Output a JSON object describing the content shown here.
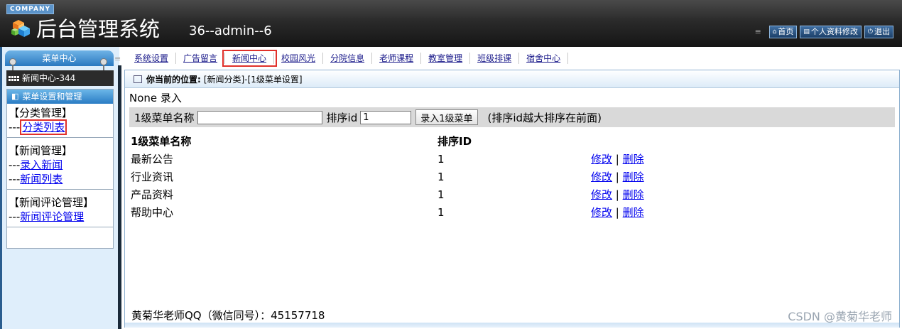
{
  "header": {
    "company": "COMPANY",
    "title": "后台管理系统",
    "user_info": "36--admin--6",
    "buttons": [
      {
        "label": "首页",
        "icon": "home-icon"
      },
      {
        "label": "个人资料修改",
        "icon": "list-icon"
      },
      {
        "label": "退出",
        "icon": "power-icon"
      }
    ]
  },
  "sidebar": {
    "menu_tab": "菜单中心",
    "news_center": "新闻中心-344",
    "box_title": "菜单设置和管理",
    "groups": [
      {
        "title": "【分类管理】",
        "links": [
          {
            "dash": "---",
            "label": "分类列表"
          }
        ]
      },
      {
        "title": "【新闻管理】",
        "links": [
          {
            "dash": "---",
            "label": "录入新闻"
          },
          {
            "dash": "---",
            "label": "新闻列表"
          }
        ]
      },
      {
        "title": "【新闻评论管理】",
        "links": [
          {
            "dash": "---",
            "label": "新闻评论管理"
          }
        ]
      }
    ]
  },
  "nav": {
    "tabs": [
      "系统设置",
      "广告留言",
      "新闻中心",
      "校园风光",
      "分院信息",
      "老师课程",
      "教室管理",
      "班级排课",
      "宿舍中心"
    ],
    "active": "新闻中心"
  },
  "main": {
    "location_label": "你当前的位置:",
    "location_path": "[新闻分类]-[1级菜单设置]",
    "subtitle": "None 录入",
    "form": {
      "name_label": "1级菜单名称",
      "name_value": "",
      "order_label": "排序id",
      "order_value": "1",
      "submit_label": "录入1级菜单",
      "hint": "(排序id越大排序在前面)"
    },
    "table": {
      "headers": [
        "1级菜单名称",
        "排序ID"
      ],
      "rows": [
        {
          "name": "最新公告",
          "order": "1",
          "edit": "修改",
          "sep": "|",
          "del": "删除"
        },
        {
          "name": "行业资讯",
          "order": "1",
          "edit": "修改",
          "sep": "|",
          "del": "删除"
        },
        {
          "name": "产品资料",
          "order": "1",
          "edit": "修改",
          "sep": "|",
          "del": "删除"
        },
        {
          "name": "帮助中心",
          "order": "1",
          "edit": "修改",
          "sep": "|",
          "del": "删除"
        }
      ]
    },
    "footer": "黄菊华老师QQ（微信同号）：45157718"
  },
  "watermark": "CSDN @黄菊华老师",
  "colors": {
    "accent": "#2a78c0",
    "highlight_border": "#e0302a",
    "link": "#0000ee"
  }
}
